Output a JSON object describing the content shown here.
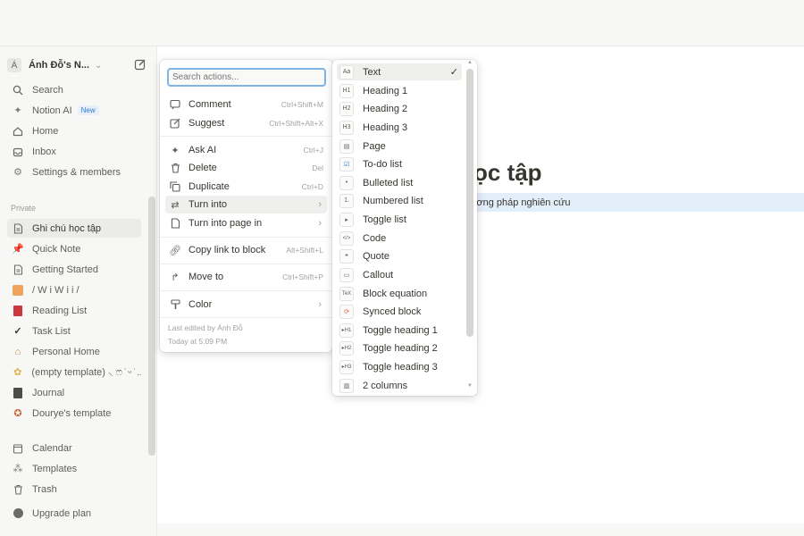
{
  "sidebar": {
    "workspace": {
      "avatar": "Á",
      "name": "Ánh Đỗ's N...",
      "chevron_icon": "chevron-down-icon",
      "edit_icon": "new-page-icon"
    },
    "top_items": [
      {
        "label": "Search",
        "icon": "search-icon"
      },
      {
        "label": "Notion AI",
        "icon": "sparkle-icon",
        "badge": "New"
      },
      {
        "label": "Home",
        "icon": "home-icon"
      },
      {
        "label": "Inbox",
        "icon": "inbox-icon"
      },
      {
        "label": "Settings & members",
        "icon": "gear-icon"
      }
    ],
    "section_label": "Private",
    "pages": [
      {
        "label": "Ghi chú học tập",
        "icon": "page-icon",
        "active": true
      },
      {
        "label": "Quick Note",
        "icon": "pin-icon"
      },
      {
        "label": "Getting Started",
        "icon": "page-icon"
      },
      {
        "label": "/ W i W i i /",
        "icon": "emoji-icon"
      },
      {
        "label": "Reading List",
        "icon": "book-icon"
      },
      {
        "label": "Task List",
        "icon": "check-icon"
      },
      {
        "label": "Personal Home",
        "icon": "house-icon"
      },
      {
        "label": "(empty template) ⸜ ෆ ̇ ᵕ ̇ ...",
        "icon": "emoji-icon"
      },
      {
        "label": "Journal",
        "icon": "journal-icon"
      },
      {
        "label": "Dourye's template",
        "icon": "emoji-icon"
      }
    ],
    "bottom_items": [
      {
        "label": "Calendar",
        "icon": "calendar-icon"
      },
      {
        "label": "Templates",
        "icon": "templates-icon"
      },
      {
        "label": "Trash",
        "icon": "trash-icon"
      }
    ],
    "upgrade": {
      "label": "Upgrade plan",
      "icon": "upgrade-icon"
    }
  },
  "page": {
    "title_fragment": "ọc tập",
    "line_fragment": "ương pháp nghiên cứu"
  },
  "menu": {
    "search_placeholder": "Search actions...",
    "items": [
      {
        "label": "Comment",
        "shortcut": "Ctrl+Shift+M",
        "icon": "comment-icon"
      },
      {
        "label": "Suggest",
        "shortcut": "Ctrl+Shift+Alt+X",
        "icon": "suggest-icon"
      },
      {
        "label": "Ask AI",
        "shortcut": "Ctrl+J",
        "icon": "sparkle-icon"
      },
      {
        "label": "Delete",
        "shortcut": "Del",
        "icon": "trash-icon"
      },
      {
        "label": "Duplicate",
        "shortcut": "Ctrl+D",
        "icon": "duplicate-icon"
      },
      {
        "label": "Turn into",
        "shortcut": "",
        "icon": "turn-into-icon",
        "has_submenu": true,
        "highlighted": true
      },
      {
        "label": "Turn into page in",
        "shortcut": "",
        "icon": "page-icon",
        "has_submenu": true
      },
      {
        "label": "Copy link to block",
        "shortcut": "Alt+Shift+L",
        "icon": "link-icon"
      },
      {
        "label": "Move to",
        "shortcut": "Ctrl+Shift+P",
        "icon": "move-icon"
      },
      {
        "label": "Color",
        "shortcut": "",
        "icon": "paint-icon",
        "has_submenu": true
      }
    ],
    "last_edited": "Last edited by Ánh Đỗ",
    "edited_time": "Today at 5:09 PM"
  },
  "submenu": {
    "items": [
      {
        "label": "Text",
        "glyph": "Aa",
        "icon": "text-icon",
        "selected": true
      },
      {
        "label": "Heading 1",
        "glyph": "H1",
        "icon": "heading-1-icon"
      },
      {
        "label": "Heading 2",
        "glyph": "H2",
        "icon": "heading-2-icon"
      },
      {
        "label": "Heading 3",
        "glyph": "H3",
        "icon": "heading-3-icon"
      },
      {
        "label": "Page",
        "glyph": "▤",
        "icon": "page-icon"
      },
      {
        "label": "To-do list",
        "glyph": "☑",
        "icon": "todo-icon"
      },
      {
        "label": "Bulleted list",
        "glyph": "•",
        "icon": "bullet-list-icon"
      },
      {
        "label": "Numbered list",
        "glyph": "1.",
        "icon": "numbered-list-icon"
      },
      {
        "label": "Toggle list",
        "glyph": "▸",
        "icon": "toggle-list-icon"
      },
      {
        "label": "Code",
        "glyph": "</>",
        "icon": "code-icon"
      },
      {
        "label": "Quote",
        "glyph": "❝",
        "icon": "quote-icon"
      },
      {
        "label": "Callout",
        "glyph": "▭",
        "icon": "callout-icon"
      },
      {
        "label": "Block equation",
        "glyph": "TeX",
        "icon": "equation-icon"
      },
      {
        "label": "Synced block",
        "glyph": "⟳",
        "icon": "synced-block-icon"
      },
      {
        "label": "Toggle heading 1",
        "glyph": "▸H1",
        "icon": "toggle-heading-1-icon"
      },
      {
        "label": "Toggle heading 2",
        "glyph": "▸H2",
        "icon": "toggle-heading-2-icon"
      },
      {
        "label": "Toggle heading 3",
        "glyph": "▸H3",
        "icon": "toggle-heading-3-icon"
      },
      {
        "label": "2 columns",
        "glyph": "▥",
        "icon": "columns-icon"
      }
    ]
  }
}
